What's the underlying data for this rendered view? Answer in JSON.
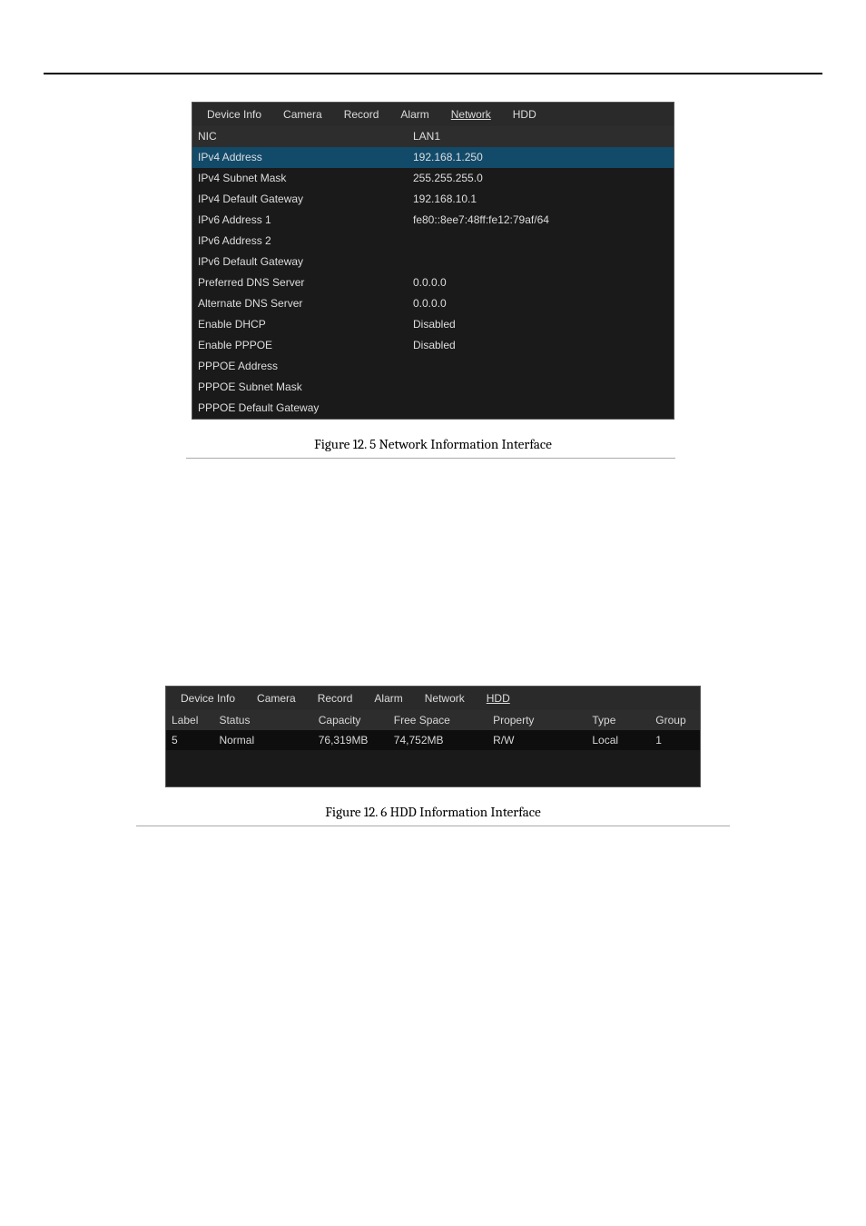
{
  "tabs": {
    "device_info": "Device Info",
    "camera": "Camera",
    "record": "Record",
    "alarm": "Alarm",
    "network": "Network",
    "hdd": "HDD"
  },
  "network": {
    "rows": [
      {
        "key": "NIC",
        "val": "LAN1",
        "cls": "header-row"
      },
      {
        "key": "IPv4 Address",
        "val": "192.168.1.250",
        "cls": "selected"
      },
      {
        "key": "IPv4 Subnet Mask",
        "val": "255.255.255.0",
        "cls": ""
      },
      {
        "key": "IPv4 Default Gateway",
        "val": "192.168.10.1",
        "cls": ""
      },
      {
        "key": "IPv6 Address 1",
        "val": "fe80::8ee7:48ff:fe12:79af/64",
        "cls": ""
      },
      {
        "key": "IPv6 Address 2",
        "val": "",
        "cls": ""
      },
      {
        "key": "IPv6 Default Gateway",
        "val": "",
        "cls": ""
      },
      {
        "key": "Preferred DNS Server",
        "val": "0.0.0.0",
        "cls": ""
      },
      {
        "key": "Alternate DNS Server",
        "val": "0.0.0.0",
        "cls": ""
      },
      {
        "key": "Enable DHCP",
        "val": "Disabled",
        "cls": ""
      },
      {
        "key": "Enable PPPOE",
        "val": "Disabled",
        "cls": ""
      },
      {
        "key": "PPPOE Address",
        "val": "",
        "cls": ""
      },
      {
        "key": "PPPOE Subnet Mask",
        "val": "",
        "cls": ""
      },
      {
        "key": "PPPOE Default Gateway",
        "val": "",
        "cls": ""
      }
    ]
  },
  "captions": {
    "fig12_5": "Figure 12. 5 Network Information Interface",
    "fig12_6": "Figure 12. 6 HDD Information Interface"
  },
  "hdd": {
    "headers": {
      "label": "Label",
      "status": "Status",
      "capacity": "Capacity",
      "free_space": "Free Space",
      "property": "Property",
      "type": "Type",
      "group": "Group"
    },
    "row": {
      "label": "5",
      "status": "Normal",
      "capacity": "76,319MB",
      "free_space": "74,752MB",
      "property": "R/W",
      "type": "Local",
      "group": "1"
    }
  }
}
